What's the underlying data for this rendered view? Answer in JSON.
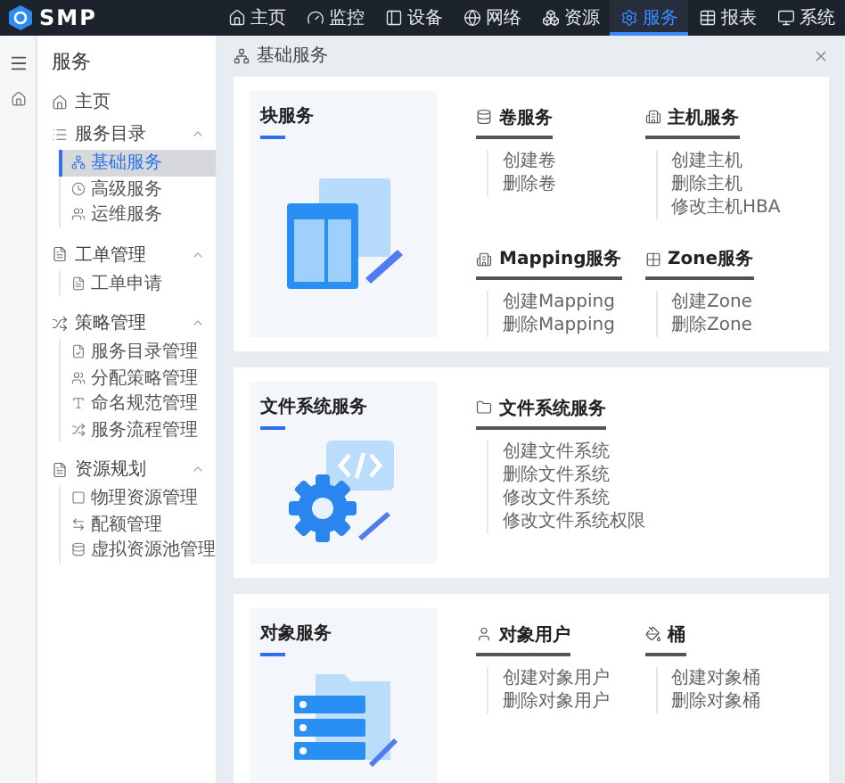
{
  "header": {
    "logo": "SMP",
    "nav": [
      {
        "label": "主页",
        "kind": "home",
        "selected": false
      },
      {
        "label": "监控",
        "kind": "gauge",
        "selected": false
      },
      {
        "label": "设备",
        "kind": "device",
        "selected": false
      },
      {
        "label": "网络",
        "kind": "globe",
        "selected": false
      },
      {
        "label": "资源",
        "kind": "boxes",
        "selected": false
      },
      {
        "label": "服务",
        "kind": "gear",
        "selected": true
      },
      {
        "label": "报表",
        "kind": "table",
        "selected": false
      },
      {
        "label": "系统",
        "kind": "monitor",
        "selected": false
      }
    ]
  },
  "sidebar": {
    "title": "服务",
    "items": [
      {
        "label": "主页",
        "kind": "home"
      },
      {
        "label": "服务目录",
        "kind": "list",
        "expanded": true,
        "children": [
          {
            "label": "基础服务",
            "kind": "nodes",
            "selected": true
          },
          {
            "label": "高级服务",
            "kind": "clock",
            "selected": false
          },
          {
            "label": "运维服务",
            "kind": "users",
            "selected": false
          }
        ]
      },
      {
        "label": "工单管理",
        "kind": "file",
        "expanded": true,
        "children": [
          {
            "label": "工单申请",
            "kind": "file",
            "selected": false
          }
        ]
      },
      {
        "label": "策略管理",
        "kind": "shuffle",
        "expanded": true,
        "children": [
          {
            "label": "服务目录管理",
            "kind": "filecheck",
            "selected": false
          },
          {
            "label": "分配策略管理",
            "kind": "users",
            "selected": false
          },
          {
            "label": "命名规范管理",
            "kind": "type",
            "selected": false
          },
          {
            "label": "服务流程管理",
            "kind": "shuffle",
            "selected": false
          }
        ]
      },
      {
        "label": "资源规划",
        "kind": "file",
        "expanded": true,
        "children": [
          {
            "label": "物理资源管理",
            "kind": "square",
            "selected": false
          },
          {
            "label": "配额管理",
            "kind": "arrows",
            "selected": false
          },
          {
            "label": "虚拟资源池管理",
            "kind": "database",
            "selected": false
          }
        ]
      }
    ]
  },
  "breadcrumb": {
    "label": "基础服务"
  },
  "cards": [
    {
      "title": "块服务",
      "kind": "block",
      "groups": [
        {
          "title": "卷服务",
          "kind": "database",
          "items": [
            "创建卷",
            "删除卷"
          ]
        },
        {
          "title": "主机服务",
          "kind": "building",
          "items": [
            "创建主机",
            "删除主机",
            "修改主机HBA"
          ]
        },
        {
          "title": "Mapping服务",
          "kind": "building",
          "items": [
            "创建Mapping",
            "删除Mapping"
          ]
        },
        {
          "title": "Zone服务",
          "kind": "grid",
          "items": [
            "创建Zone",
            "删除Zone"
          ]
        }
      ]
    },
    {
      "title": "文件系统服务",
      "kind": "file",
      "groups": [
        {
          "title": "文件系统服务",
          "kind": "folder",
          "items": [
            "创建文件系统",
            "删除文件系统",
            "修改文件系统",
            "修改文件系统权限"
          ]
        }
      ]
    },
    {
      "title": "对象服务",
      "kind": "object",
      "groups": [
        {
          "title": "对象用户",
          "kind": "user",
          "items": [
            "创建对象用户",
            "删除对象用户"
          ]
        },
        {
          "title": "桶",
          "kind": "bucket",
          "items": [
            "创建对象桶",
            "删除对象桶"
          ]
        }
      ]
    }
  ]
}
